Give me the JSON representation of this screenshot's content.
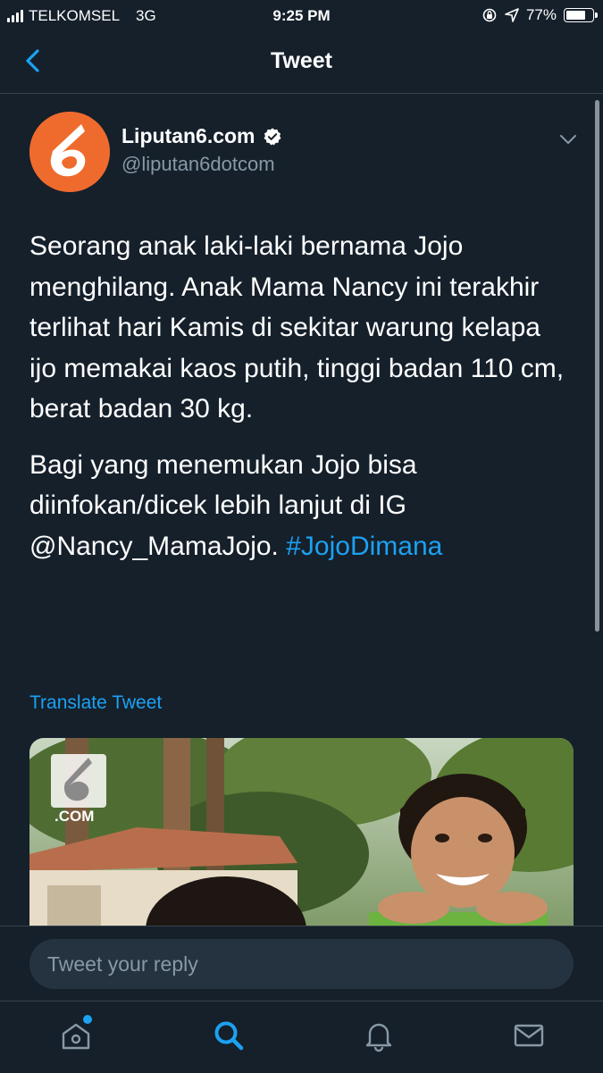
{
  "status_bar": {
    "carrier": "TELKOMSEL",
    "network": "3G",
    "time": "9:25 PM",
    "battery": "77%",
    "battery_level": 0.77
  },
  "header": {
    "title": "Tweet",
    "back_icon": "chevron-left-icon"
  },
  "tweet": {
    "author_name": "Liputan6.com",
    "author_handle": "@liputan6dotcom",
    "verified": true,
    "paragraph_1": "Seorang anak laki-laki bernama Jojo menghilang. Anak Mama Nancy ini terakhir terlihat hari Kamis di sekitar warung kelapa ijo memakai kaos putih, tinggi badan 110 cm, berat badan 30 kg.",
    "paragraph_2_text": "Bagi yang menemukan Jojo bisa diinfokan/dicek lebih lanjut di IG",
    "mention": "@Nancy_MamaJojo.",
    "hashtag": "#JojoDimana",
    "translate_label": "Translate Tweet",
    "media_watermark": ".COM"
  },
  "reply": {
    "placeholder": "Tweet your reply"
  },
  "tabbar": {
    "items": [
      "home-icon",
      "search-icon",
      "notifications-icon",
      "messages-icon"
    ],
    "active": "search-icon"
  },
  "colors": {
    "background": "#15202b",
    "accent": "#1da1f2",
    "secondary_text": "#8899a6",
    "divider": "#38444d"
  }
}
